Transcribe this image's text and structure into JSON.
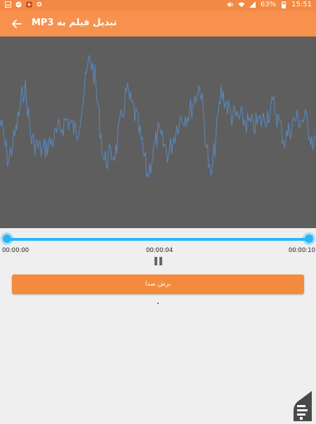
{
  "status_bar": {
    "battery": "63%",
    "time": "15:51",
    "icons": [
      "gallery-icon",
      "messenger-icon",
      "app-icon",
      "settings-icon",
      "mute-icon",
      "wifi-icon",
      "signal-icon",
      "battery-icon"
    ]
  },
  "app_bar": {
    "title": "تبدیل فیلم به MP3",
    "back_icon": "arrow-left-icon"
  },
  "player": {
    "start_time": "00:00:00",
    "current_time": "00:00:04",
    "end_time": "00:00:10",
    "selection_start": 0,
    "selection_end": 1,
    "pause_icon": "pause-icon"
  },
  "cut_button": {
    "label": "برش صدا"
  },
  "colors": {
    "app_bar": "#f8914d",
    "waveform_bg": "#5e5e5e",
    "waveform_line": "#5b86b8",
    "accent": "#29b6f6",
    "button": "#f48a3d"
  }
}
